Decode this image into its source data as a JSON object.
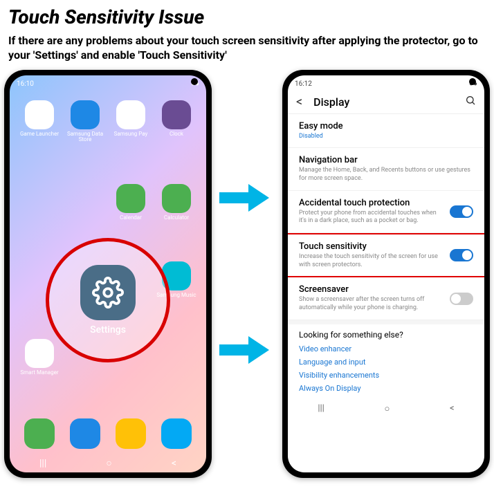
{
  "header": {
    "title": "Touch Sensitivity Issue",
    "subtitle": "If there are any problems about your touch screen sensitivity after applying the protector, go to your 'Settings' and enable 'Touch Sensitivity'"
  },
  "home": {
    "time": "16:10",
    "apps": [
      {
        "label": "Game Launcher",
        "color": "#ffffff"
      },
      {
        "label": "Samsung Data Store",
        "color": "#1e88e5"
      },
      {
        "label": "Samsung Pay",
        "color": "#ffffff"
      },
      {
        "label": "Clock",
        "color": "#6a4c93"
      },
      {
        "label": "Calendar",
        "color": "#4caf50"
      },
      {
        "label": "Calculator",
        "color": "#4caf50"
      },
      {
        "label": "Samsung Music",
        "color": "#00bcd4"
      },
      {
        "label": "Smart Manager",
        "color": "#ffffff"
      }
    ],
    "settings_label": "Settings",
    "dock": [
      "#4caf50",
      "#1e88e5",
      "#ffc107",
      "#03a9f4"
    ]
  },
  "display": {
    "time": "16:12",
    "screen_title": "Display",
    "rows": [
      {
        "title": "Easy mode",
        "sub": "Disabled",
        "sub_color": "#1976d2"
      },
      {
        "title": "Navigation bar",
        "sub": "Manage the Home, Back, and Recents buttons or use gestures for more screen space."
      },
      {
        "title": "Accidental touch protection",
        "sub": "Protect your phone from accidental touches when it's in a dark place, such as a pocket or bag.",
        "toggle": "on"
      },
      {
        "title": "Touch sensitivity",
        "sub": "Increase the touch sensitivity of the screen for use with screen protectors.",
        "toggle": "on",
        "highlight": true
      },
      {
        "title": "Screensaver",
        "sub": "Show a screensaver after the screen turns off automatically while your phone is charging.",
        "toggle": "off"
      }
    ],
    "looking": "Looking for something else?",
    "links": [
      "Video enhancer",
      "Language and input",
      "Visibility enhancements",
      "Always On Display"
    ]
  }
}
